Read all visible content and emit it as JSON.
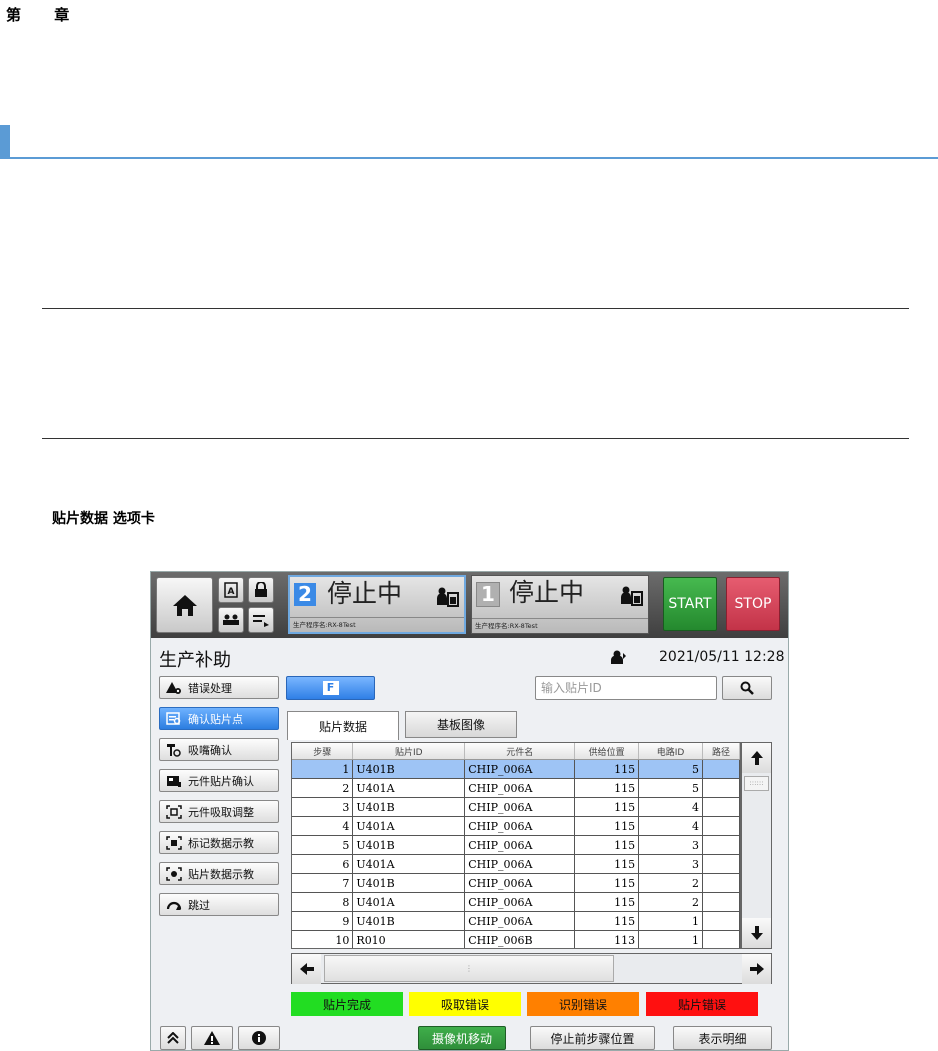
{
  "doc": {
    "chapter": "第 章",
    "caption": "贴片数据 选项卡"
  },
  "topbar": {
    "panels": [
      {
        "number": "2",
        "status": "停止中",
        "program": "生产程序名:RX-8Test"
      },
      {
        "number": "1",
        "status": "停止中",
        "program": "生产程序名:RX-8Test"
      }
    ],
    "start_label": "START",
    "stop_label": "STOP"
  },
  "header": {
    "title": "生产补助",
    "datetime": "2021/05/11 12:28"
  },
  "sidebar": {
    "items": [
      {
        "label": "错误处理",
        "icon": "warning-gear-icon"
      },
      {
        "label": "确认贴片点",
        "icon": "list-search-icon",
        "selected": true
      },
      {
        "label": "吸嘴确认",
        "icon": "nozzle-search-icon"
      },
      {
        "label": "元件贴片确认",
        "icon": "component-icon"
      },
      {
        "label": "元件吸取调整",
        "icon": "target-frame-icon"
      },
      {
        "label": "标记数据示教",
        "icon": "mark-frame-icon"
      },
      {
        "label": "贴片数据示教",
        "icon": "placement-frame-icon"
      },
      {
        "label": "跳过",
        "icon": "skip-arc-icon"
      }
    ]
  },
  "toolbar": {
    "filter_label": "F",
    "search_placeholder": "输入贴片ID"
  },
  "tabs": [
    "贴片数据",
    "基板图像"
  ],
  "table": {
    "headers": [
      "步骤",
      "贴片ID",
      "元件名",
      "供给位置",
      "电路ID",
      "路径"
    ],
    "rows": [
      [
        "1",
        "U401B",
        "CHIP_006A",
        "115",
        "5",
        ""
      ],
      [
        "2",
        "U401A",
        "CHIP_006A",
        "115",
        "5",
        ""
      ],
      [
        "3",
        "U401B",
        "CHIP_006A",
        "115",
        "4",
        ""
      ],
      [
        "4",
        "U401A",
        "CHIP_006A",
        "115",
        "4",
        ""
      ],
      [
        "5",
        "U401B",
        "CHIP_006A",
        "115",
        "3",
        ""
      ],
      [
        "6",
        "U401A",
        "CHIP_006A",
        "115",
        "3",
        ""
      ],
      [
        "7",
        "U401B",
        "CHIP_006A",
        "115",
        "2",
        ""
      ],
      [
        "8",
        "U401A",
        "CHIP_006A",
        "115",
        "2",
        ""
      ],
      [
        "9",
        "U401B",
        "CHIP_006A",
        "115",
        "1",
        ""
      ],
      [
        "10",
        "R010",
        "CHIP_006B",
        "113",
        "1",
        ""
      ]
    ],
    "selected_row": 0
  },
  "legend": [
    {
      "label": "贴片完成",
      "color": "#22dd22"
    },
    {
      "label": "吸取错误",
      "color": "#ffff00"
    },
    {
      "label": "识别错误",
      "color": "#ff8000"
    },
    {
      "label": "贴片错误",
      "color": "#ff1010"
    }
  ],
  "bottom": {
    "camera_move": "摄像机移动",
    "stop_prev_step": "停止前步骤位置",
    "show_detail": "表示明细"
  },
  "colors": {
    "start": "#2ea23a",
    "stop": "#d9455a",
    "accent": "#2f7fe6",
    "camera_move": "#2f8f3a"
  }
}
